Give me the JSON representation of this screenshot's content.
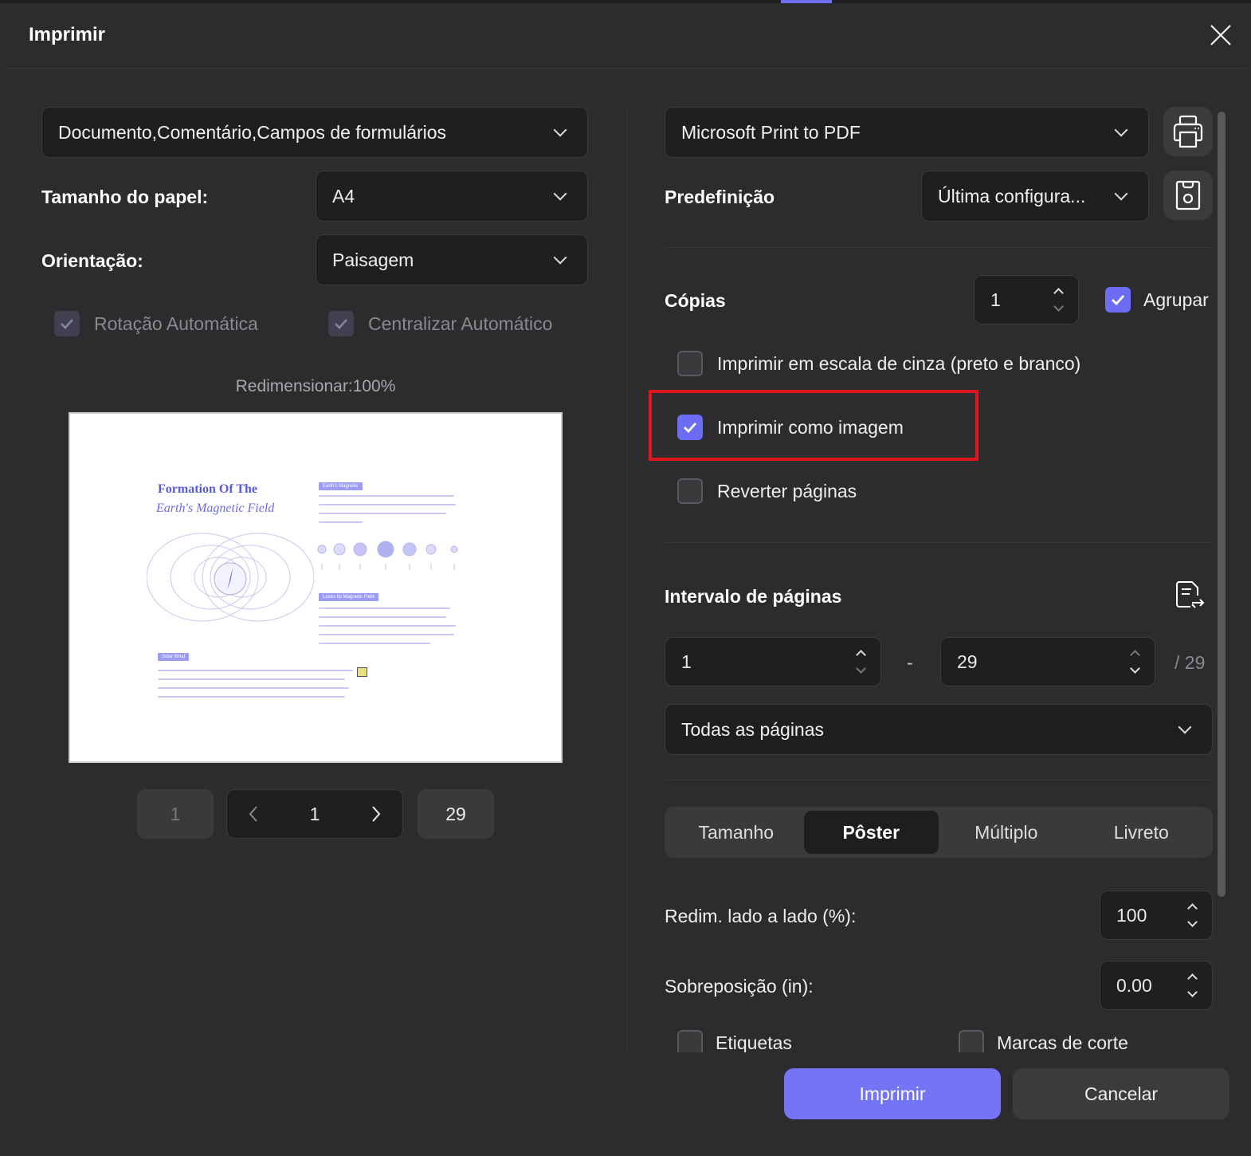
{
  "dialog": {
    "title": "Imprimir"
  },
  "left": {
    "content_select": "Documento,Comentário,Campos de formulários",
    "paper_size_label": "Tamanho do papel:",
    "paper_size": "A4",
    "orientation_label": "Orientação:",
    "orientation": "Paisagem",
    "auto_rotate": "Rotação Automática",
    "auto_center": "Centralizar Automático",
    "resize": "Redimensionar:100%",
    "preview": {
      "title1": "Formation Of The",
      "title2": "Earth's Magnetic Field",
      "tag1": "Earth's Magnetic",
      "tag2": "Loses Its Magnetic Field",
      "tag3": "Solar Wind"
    },
    "pager": {
      "first": "1",
      "current": "1",
      "last": "29"
    }
  },
  "right": {
    "printer": "Microsoft Print to PDF",
    "preset_label": "Predefinição",
    "preset": "Última configura...",
    "copies_label": "Cópias",
    "copies": "1",
    "collate": "Agrupar",
    "grayscale": "Imprimir em escala de cinza (preto e branco)",
    "as_image": "Imprimir como imagem",
    "reverse": "Reverter páginas",
    "range_label": "Intervalo de páginas",
    "range_from": "1",
    "range_dash": "-",
    "range_to": "29",
    "range_total": "/ 29",
    "range_select": "Todas as páginas",
    "tabs": [
      "Tamanho",
      "Pôster",
      "Múltiplo",
      "Livreto"
    ],
    "tile_scale_label": "Redim. lado a lado (%):",
    "tile_scale": "100",
    "overlap_label": "Sobreposição (in):",
    "overlap": "0.00",
    "labels": "Etiquetas",
    "cut_marks": "Marcas de corte"
  },
  "footer": {
    "print": "Imprimir",
    "cancel": "Cancelar"
  },
  "colors": {
    "accent": "#6f6ff5",
    "highlight": "#e0141e"
  }
}
